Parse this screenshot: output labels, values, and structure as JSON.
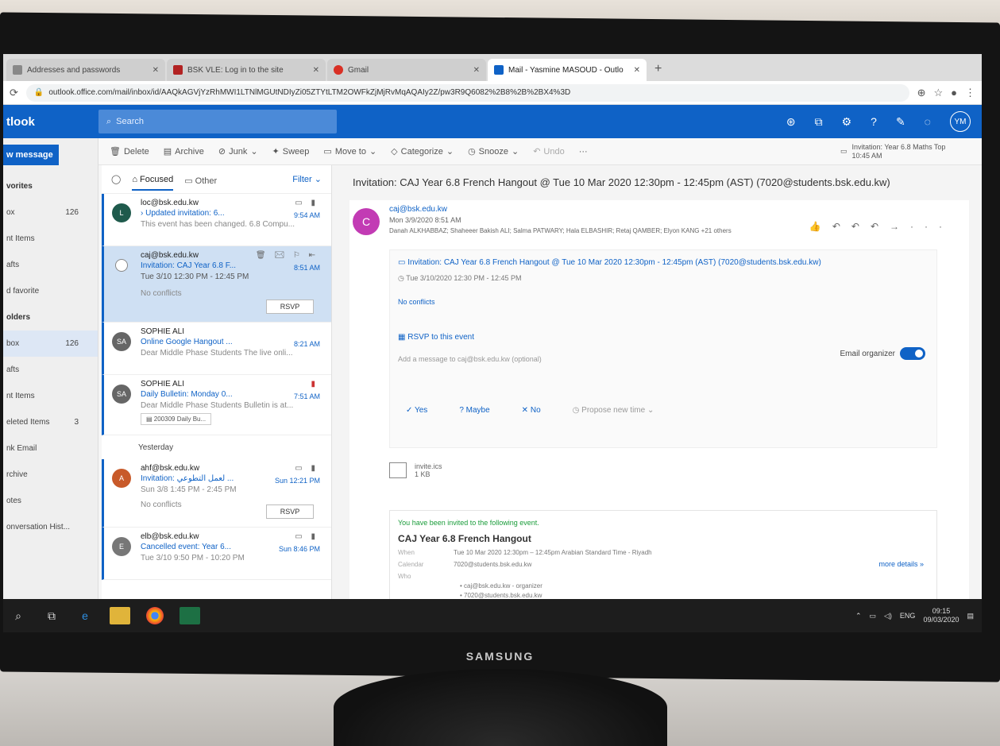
{
  "browser": {
    "tabs": [
      {
        "label": "Addresses and passwords",
        "color": "#888888"
      },
      {
        "label": "BSK VLE: Log in to the site",
        "color": "#b22222"
      },
      {
        "label": "Gmail",
        "color": "#d93025"
      },
      {
        "label": "Mail - Yasmine MASOUD - Outlo",
        "color": "#0f62c6"
      }
    ],
    "url": "outlook.office.com/mail/inbox/id/AAQkAGVjYzRhMWI1LTNlMGUtNDIyZi05ZTYtLTM2OWFkZjMjRvMqAQAIy2Z/pw3R9Q6082%2B8%2B%2BX4%3D"
  },
  "outlook": {
    "brand": "tlook",
    "search_placeholder": "Search",
    "avatar_initials": "YM",
    "new_message": "w message",
    "nav": [
      {
        "label": "vorites",
        "count": "",
        "head": true
      },
      {
        "label": "ox",
        "count": "126"
      },
      {
        "label": "nt Items",
        "count": ""
      },
      {
        "label": "afts",
        "count": ""
      },
      {
        "label": "d favorite",
        "count": ""
      },
      {
        "label": "olders",
        "count": "",
        "head": true
      },
      {
        "label": "box",
        "count": "126",
        "sel": true
      },
      {
        "label": "afts",
        "count": ""
      },
      {
        "label": "nt Items",
        "count": ""
      },
      {
        "label": "eleted Items",
        "count": "3"
      },
      {
        "label": "nk Email",
        "count": ""
      },
      {
        "label": "rchive",
        "count": ""
      },
      {
        "label": "otes",
        "count": ""
      },
      {
        "label": "onversation Hist...",
        "count": ""
      }
    ],
    "toolbar": {
      "delete": "Delete",
      "archive": "Archive",
      "junk": "Junk",
      "sweep": "Sweep",
      "move_to": "Move to",
      "categorize": "Categorize",
      "snooze": "Snooze",
      "undo": "Undo",
      "reminder_title": "Invitation: Year 6.8 Maths Top",
      "reminder_time": "10:45 AM"
    },
    "list": {
      "focused": "Focused",
      "other": "Other",
      "filter": "Filter",
      "yesterday": "Yesterday",
      "messages": [
        {
          "from": "loc@bsk.edu.kw",
          "subject": "Updated invitation: 6...",
          "preview": "This event has been changed. 6.8 Compu...",
          "time": "9:54 AM",
          "avatar": "L",
          "color": "#1f5a4c"
        },
        {
          "from": "caj@bsk.edu.kw",
          "subject": "Invitation: CAJ Year 6.8 F...",
          "preview": "Tue 3/10 12:30 PM - 12:45 PM",
          "time": "8:51 AM",
          "note": "No conflicts",
          "rsvp": "RSVP",
          "selected": true
        },
        {
          "from": "SOPHIE ALI",
          "subject": "Online Google Hangout ...",
          "preview": "Dear Middle Phase Students The live onli...",
          "time": "8:21 AM",
          "avatar": "SA",
          "color": "#666666"
        },
        {
          "from": "SOPHIE ALI",
          "subject": "Daily Bulletin: Monday 0...",
          "preview": "Dear Middle Phase Students Bulletin is at...",
          "time": "7:51 AM",
          "avatar": "SA",
          "color": "#666666",
          "attachment": "200309 Daily Bu..."
        }
      ],
      "messages_yesterday": [
        {
          "from": "ahf@bsk.edu.kw",
          "subject": "Invitation: لعمل التطوعي ...",
          "preview": "Sun 3/8 1:45 PM - 2:45 PM",
          "time": "Sun 12:21 PM",
          "avatar": "A",
          "color": "#c85a2a",
          "note": "No conflicts",
          "rsvp": "RSVP"
        },
        {
          "from": "elb@bsk.edu.kw",
          "subject": "Cancelled event: Year 6...",
          "preview": "Tue 3/10 9:50 PM - 10:20 PM",
          "time": "Sun 8:46 PM",
          "avatar": "E",
          "color": "#777777"
        }
      ]
    },
    "reading": {
      "subject": "Invitation: CAJ Year 6.8 French Hangout @ Tue 10 Mar 2020 12:30pm - 12:45pm (AST) (7020@students.bsk.edu.kw)",
      "sender_initial": "C",
      "from": "caj@bsk.edu.kw",
      "date": "Mon 3/9/2020 8:51 AM",
      "to": "Danah ALKHABBAZ; Shaheeer Bakish ALI; Salma PATWARY; Hala ELBASHIR; Retaj QAMBER; Elyon KANG +21 others",
      "invite_title": "Invitation: CAJ Year 6.8 French Hangout @ Tue 10 Mar 2020 12:30pm - 12:45pm (AST) (7020@students.bsk.edu.kw)",
      "invite_time": "Tue 3/10/2020 12:30 PM - 12:45 PM",
      "no_conflicts": "No conflicts",
      "rsvp_event": "RSVP to this event",
      "message_placeholder": "Add a message to caj@bsk.edu.kw (optional)",
      "email_organizer": "Email organizer",
      "yes": "Yes",
      "maybe": "Maybe",
      "no": "No",
      "propose": "Propose new time",
      "attachment_name": "invite.ics",
      "attachment_size": "1 KB",
      "invited_text": "You have been invited to the following event.",
      "event_name": "CAJ Year 6.8 French Hangout",
      "when_label": "When",
      "when_value": "Tue 10 Mar 2020 12:30pm – 12:45pm Arabian Standard Time - Riyadh",
      "calendar_label": "Calendar",
      "calendar_value": "7020@students.bsk.edu.kw",
      "who_label": "Who",
      "who": [
        "caj@bsk.edu.kw - organizer",
        "7020@students.bsk.edu.kw"
      ],
      "more_details": "more details »"
    }
  },
  "taskbar": {
    "lang": "ENG",
    "time": "09:15",
    "date": "09/03/2020"
  },
  "monitor": {
    "brand": "SAMSUNG"
  }
}
